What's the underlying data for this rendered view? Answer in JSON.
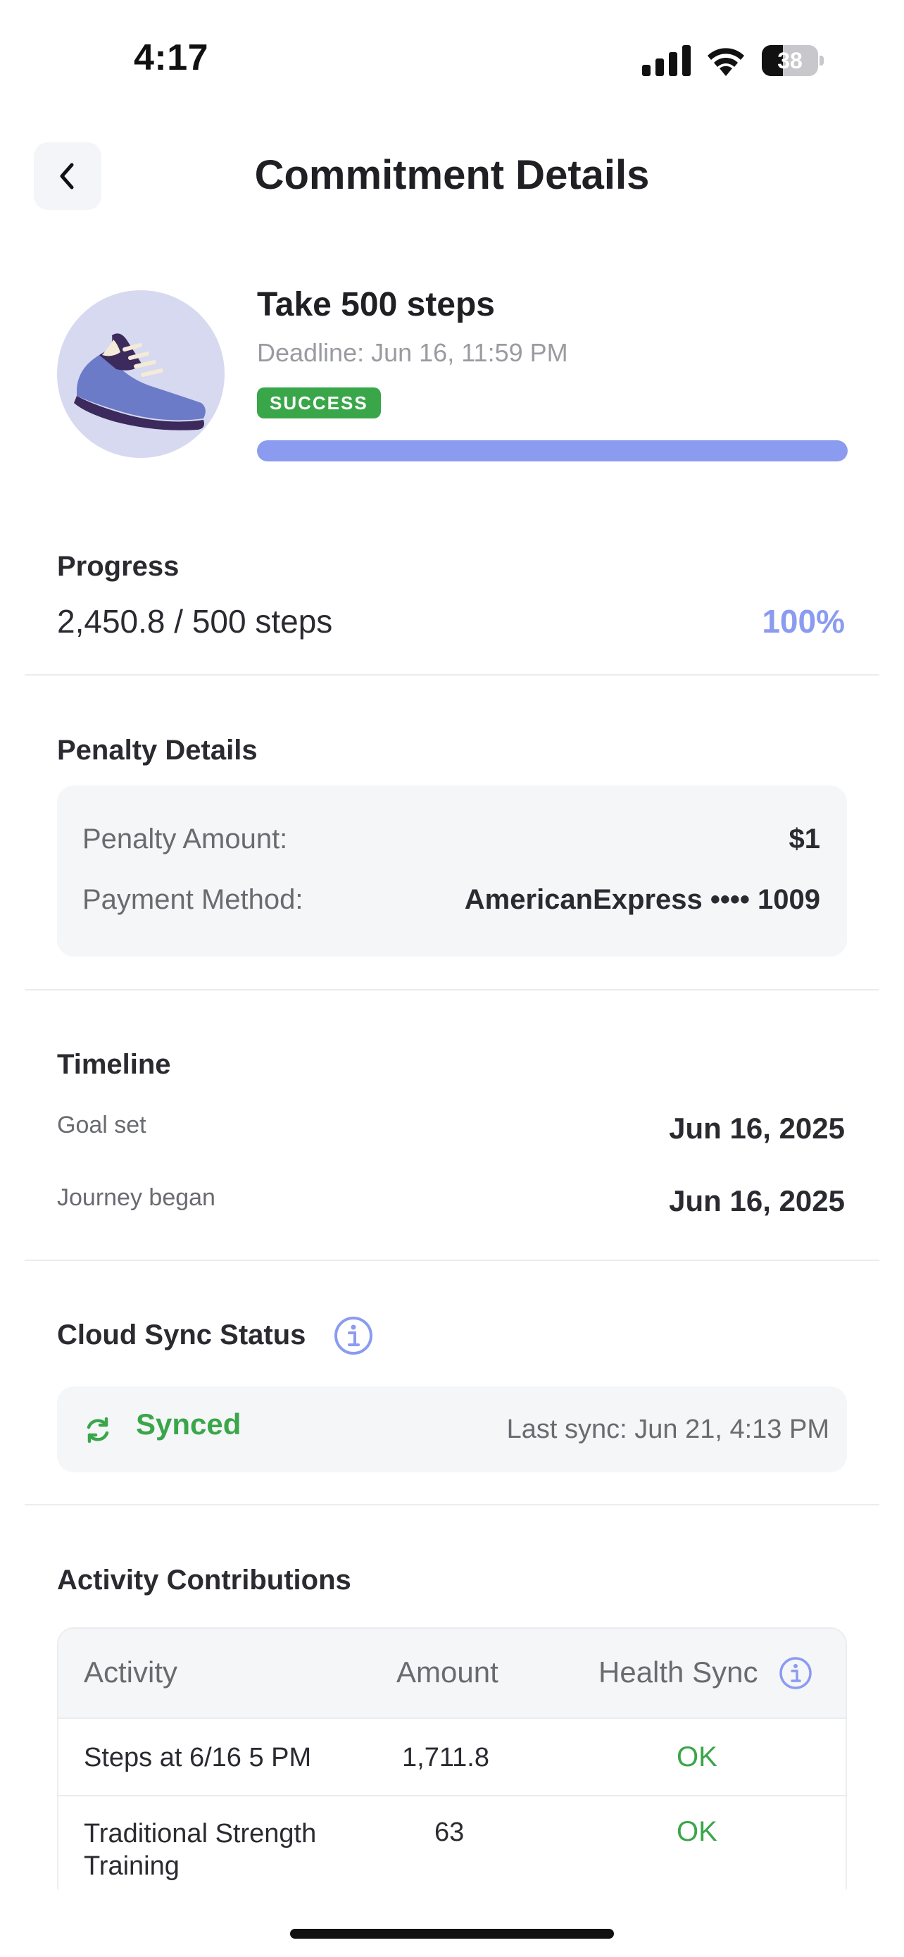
{
  "status_bar": {
    "time": "4:17",
    "battery": "38",
    "battery_level": 0.38
  },
  "header": {
    "title": "Commitment Details",
    "back_icon": "chevron-left-icon"
  },
  "summary": {
    "icon": "sneaker-icon",
    "title": "Take 500 steps",
    "deadline": "Deadline: Jun 16, 11:59 PM",
    "status": "SUCCESS",
    "progress_fraction": 1.0
  },
  "progress": {
    "heading": "Progress",
    "value": "2,450.8 / 500 steps",
    "percent": "100%"
  },
  "penalty": {
    "heading": "Penalty Details",
    "amount_label": "Penalty Amount:",
    "amount_value": "$1",
    "method_label": "Payment Method:",
    "method_value": "AmericanExpress •••• 1009"
  },
  "timeline": {
    "heading": "Timeline",
    "items": [
      {
        "label": "Goal set",
        "value": "Jun 16, 2025"
      },
      {
        "label": "Journey began",
        "value": "Jun 16, 2025"
      }
    ]
  },
  "sync": {
    "heading": "Cloud Sync Status",
    "status": "Synced",
    "last_sync": "Last sync: Jun 21, 4:13 PM"
  },
  "activities": {
    "heading": "Activity Contributions",
    "columns": [
      "Activity",
      "Amount",
      "Health Sync"
    ],
    "rows": [
      {
        "activity": "Steps at 6/16 5 PM",
        "amount": "1,711.8",
        "health_sync": "OK"
      },
      {
        "activity": "Traditional Strength Training",
        "amount": "63",
        "health_sync": "OK"
      }
    ]
  },
  "colors": {
    "accent": "#8a9bf0",
    "success": "#3aa64a",
    "card_bg": "#f5f6f8",
    "muted_text": "#6a6b70"
  }
}
